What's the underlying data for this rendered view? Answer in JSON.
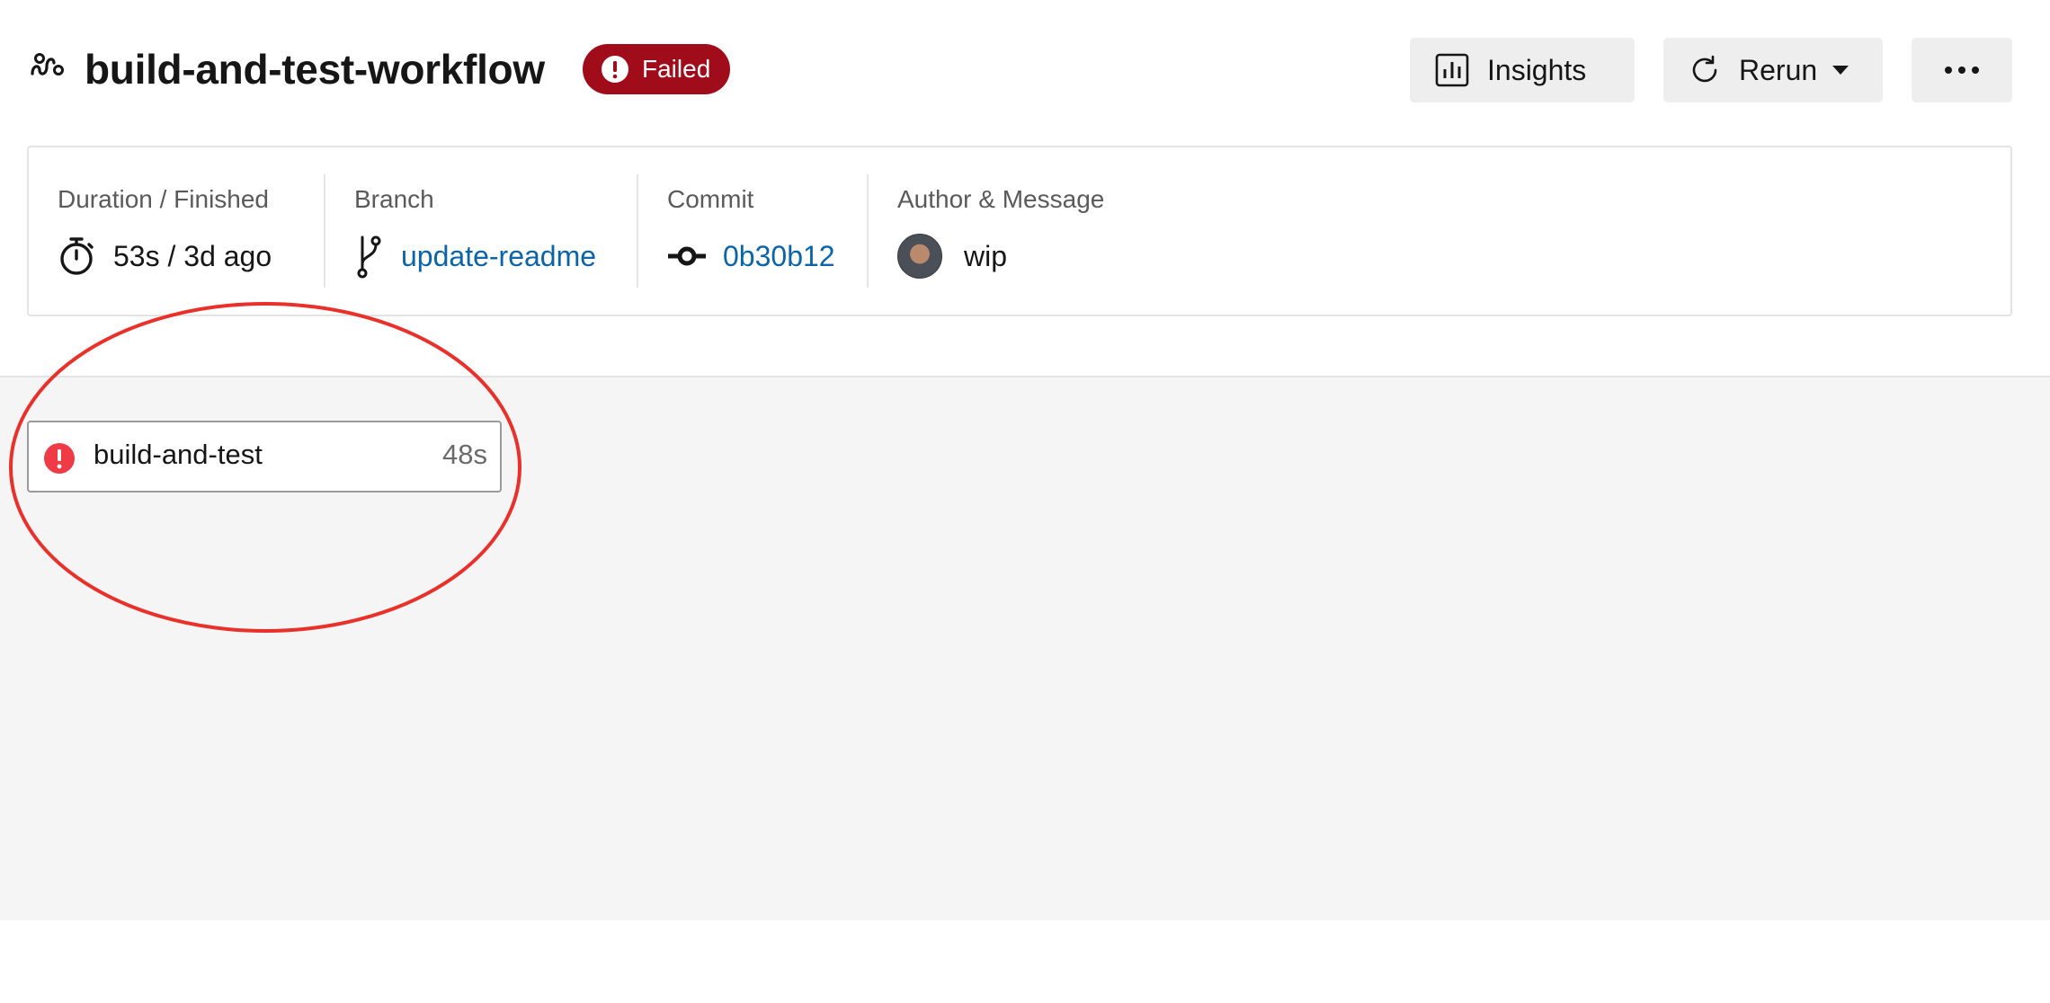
{
  "header": {
    "title": "build-and-test-workflow",
    "status": "Failed",
    "insights_label": "Insights",
    "rerun_label": "Rerun",
    "more_label": "more options"
  },
  "info": {
    "duration": {
      "label": "Duration / Finished",
      "value": "53s / 3d ago"
    },
    "branch": {
      "label": "Branch",
      "value": "update-readme"
    },
    "commit": {
      "label": "Commit",
      "value": "0b30b12"
    },
    "author": {
      "label": "Author & Message",
      "message": "wip"
    }
  },
  "jobs": [
    {
      "name": "build-and-test",
      "duration": "48s",
      "status": "failed"
    }
  ],
  "colors": {
    "failed_pill": "#a10c1a",
    "failed_icon": "#ef3b46",
    "link": "#0b64a8",
    "annotation": "#e8312a"
  },
  "icons": {
    "workflow": "workflow-icon",
    "status": "exclamation-circle-icon",
    "insights": "bar-chart-icon",
    "rerun": "refresh-icon",
    "more": "ellipsis-icon",
    "duration": "stopwatch-icon",
    "branch": "git-branch-icon",
    "commit": "git-commit-icon"
  }
}
